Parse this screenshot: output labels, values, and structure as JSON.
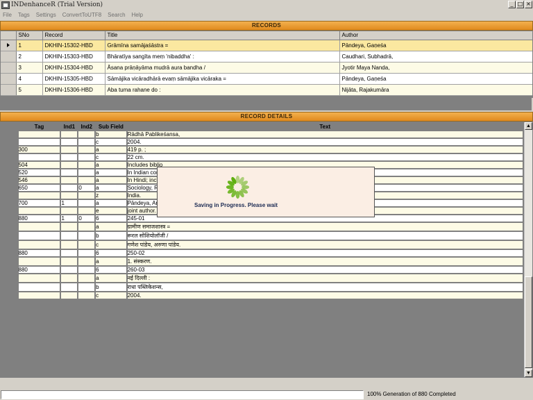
{
  "app": {
    "title": "INDenhanceR (Trial Version)",
    "window_buttons": [
      "_",
      "□",
      "×"
    ]
  },
  "menu": [
    "File",
    "Tags",
    "Settings",
    "ConvertToUTF8",
    "Search",
    "Help"
  ],
  "records": {
    "header": "RECORDS",
    "columns": [
      "SNo",
      "Record",
      "Title",
      "Author"
    ],
    "rows": [
      {
        "sno": "1",
        "record": "DKHIN-15302-HBD",
        "title": "Grāmīna samājaśāstra =",
        "author": "Pāndeya, Gaṇeśa"
      },
      {
        "sno": "2",
        "record": "DKHIN-15303-HBD",
        "title": "Bhāratīya sangīta meṃ 'nibaddha' :",
        "author": "Caudhari, Subhadrā,"
      },
      {
        "sno": "3",
        "record": "DKHIN-15304-HBD",
        "title": "Āsana prāṇāyāma mudrā aura bandha /",
        "author": "Jyotir Maya Nanda,"
      },
      {
        "sno": "4",
        "record": "DKHIN-15305-HBD",
        "title": "Sāmājika vicāradhārā evaṃ sāmājika vicāraka =",
        "author": "Pāndeya, Gaṇeśa"
      },
      {
        "sno": "5",
        "record": "DKHIN-15306-HBD",
        "title": "Aba tuma rahane do :",
        "author": "Nijāta, Rajakumāra"
      }
    ]
  },
  "details": {
    "header": "RECORD DETAILS",
    "columns": [
      "Tag",
      "Ind1",
      "Ind2",
      "Sub Field",
      "Text"
    ],
    "rows": [
      {
        "tag": "",
        "ind1": "",
        "ind2": "",
        "sub": "b",
        "text": "Rādhā Pablikeśansa,"
      },
      {
        "tag": "",
        "ind1": "",
        "ind2": "",
        "sub": "c",
        "text": "2004."
      },
      {
        "tag": "300",
        "ind1": "",
        "ind2": "",
        "sub": "a",
        "text": "419 p. ;"
      },
      {
        "tag": "",
        "ind1": "",
        "ind2": "",
        "sub": "c",
        "text": "22 cm."
      },
      {
        "tag": "504",
        "ind1": "",
        "ind2": "",
        "sub": "a",
        "text": "Includes biblio"
      },
      {
        "tag": "520",
        "ind1": "",
        "ind2": "",
        "sub": "a",
        "text": "In Indian conte"
      },
      {
        "tag": "546",
        "ind1": "",
        "ind2": "",
        "sub": "a",
        "text": "In Hindi; incluc"
      },
      {
        "tag": "650",
        "ind1": "",
        "ind2": "0",
        "sub": "a",
        "text": "Sociology, Rur"
      },
      {
        "tag": "",
        "ind1": "",
        "ind2": "",
        "sub": "z",
        "text": "India."
      },
      {
        "tag": "700",
        "ind1": "1",
        "ind2": "",
        "sub": "a",
        "text": "Pāndeya, Aruṇā"
      },
      {
        "tag": "",
        "ind1": "",
        "ind2": "",
        "sub": "e",
        "text": "joint author."
      },
      {
        "tag": "880",
        "ind1": "1",
        "ind2": "0",
        "sub": "6",
        "text": "245-01"
      },
      {
        "tag": "",
        "ind1": "",
        "ind2": "",
        "sub": "a",
        "text": "ग्रामीण समाजशास्त्र ="
      },
      {
        "tag": "",
        "ind1": "",
        "ind2": "",
        "sub": "b",
        "text": "रूरल सोशियोलॉजी /"
      },
      {
        "tag": "",
        "ind1": "",
        "ind2": "",
        "sub": "c",
        "text": "गणेश पांडेय, अरुणा पांडेय."
      },
      {
        "tag": "880",
        "ind1": "",
        "ind2": "",
        "sub": "6",
        "text": "250-02"
      },
      {
        "tag": "",
        "ind1": "",
        "ind2": "",
        "sub": "a",
        "text": "1. संस्करण."
      },
      {
        "tag": "880",
        "ind1": "",
        "ind2": "",
        "sub": "6",
        "text": "260-03"
      },
      {
        "tag": "",
        "ind1": "",
        "ind2": "",
        "sub": "a",
        "text": "नई दिल्ली :"
      },
      {
        "tag": "",
        "ind1": "",
        "ind2": "",
        "sub": "b",
        "text": "राधा पब्लिकेशन्स,"
      },
      {
        "tag": "",
        "ind1": "",
        "ind2": "",
        "sub": "c",
        "text": "2004."
      }
    ]
  },
  "dialog": {
    "message": "Saving in Progress. Please wait",
    "icon": "spinner-icon"
  },
  "status": {
    "progress_text": "100% Generation of 880 Completed"
  },
  "colors": {
    "header_orange": "#e8951f",
    "spinner_green": "#5faf0f",
    "row_highlight": "#fdfbe6"
  }
}
